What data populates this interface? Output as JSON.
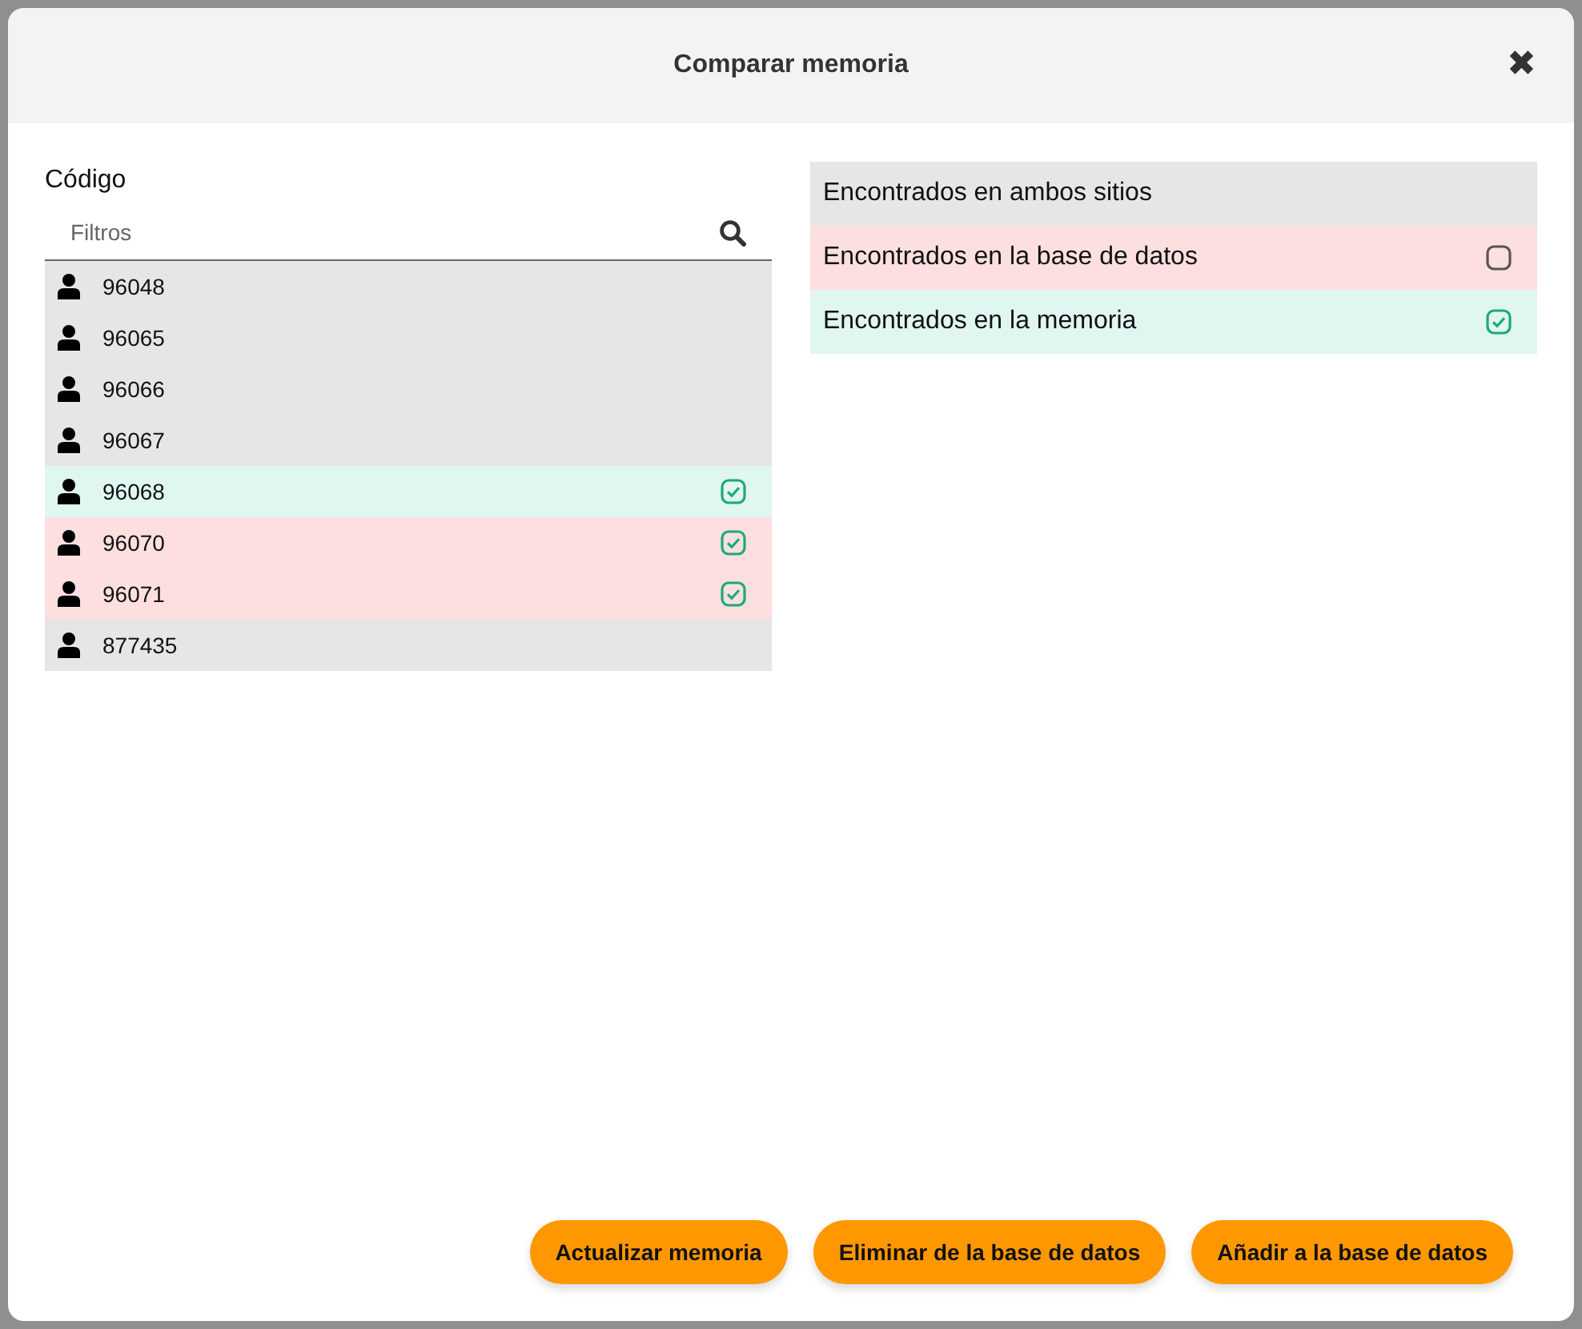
{
  "dialog": {
    "title": "Comparar memoria",
    "close": "✖"
  },
  "code_list": {
    "label": "Código",
    "filter": {
      "placeholder": "Filtros"
    },
    "rows": [
      {
        "code": "96048",
        "color": "#e7e5e6",
        "checked": false
      },
      {
        "code": "96065",
        "color": "#e7e5e6",
        "checked": false
      },
      {
        "code": "96066",
        "color": "#e7e5e6",
        "checked": false
      },
      {
        "code": "96067",
        "color": "#e7e5e6",
        "checked": false
      },
      {
        "code": "96068",
        "color": "#e0f6f0",
        "checked": true
      },
      {
        "code": "96070",
        "color": "#fddfe0",
        "checked": true
      },
      {
        "code": "96071",
        "color": "#fddfe0",
        "checked": true
      },
      {
        "code": "877435",
        "color": "#e7e5e6",
        "checked": false
      }
    ]
  },
  "legend": [
    {
      "label": "Encontrados en ambos sitios",
      "color": "#e7e5e6",
      "kind": "plain"
    },
    {
      "label": "Encontrados en la base de datos",
      "color": "#fddfe0",
      "kind": "checkbox",
      "checked": false
    },
    {
      "label": "Encontrados en la memoria",
      "color": "#e0f6f0",
      "kind": "checkbox",
      "checked": true
    }
  ],
  "buttons": [
    "Actualizar memoria",
    "Eliminar de la base de datos",
    "Añadir a la base de datos"
  ]
}
